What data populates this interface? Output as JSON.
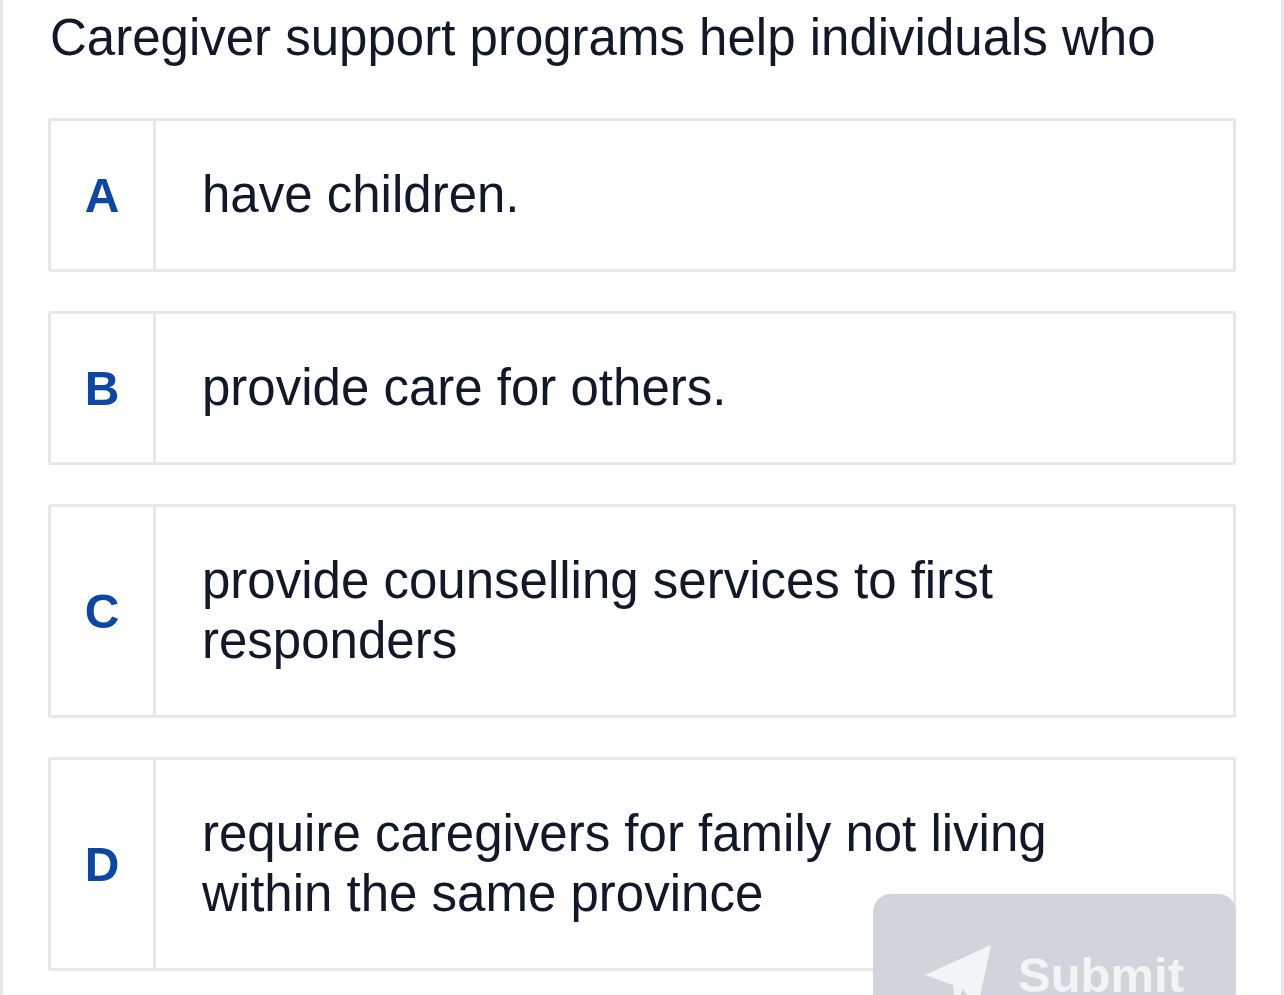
{
  "question": "Caregiver support programs help individuals who",
  "options": [
    {
      "letter": "A",
      "text": "have children.",
      "selected": false
    },
    {
      "letter": "B",
      "text": "provide care for others.",
      "selected": false
    },
    {
      "letter": "C",
      "text": "provide counselling services to first responders",
      "selected": false
    },
    {
      "letter": "D",
      "text": "require caregivers for family not living within the same province",
      "selected": false
    }
  ],
  "submit": {
    "label": "Submit",
    "disabled": true
  }
}
